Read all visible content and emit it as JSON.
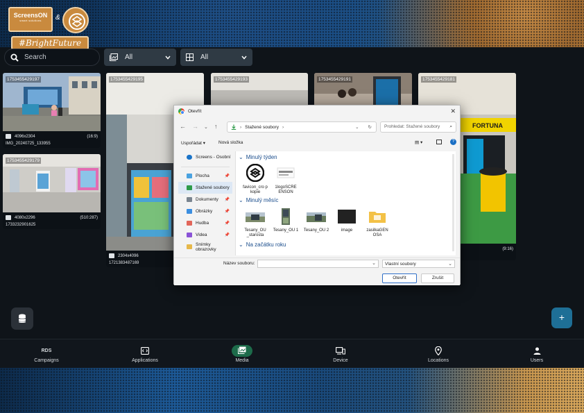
{
  "header": {
    "brand": "ScreensON",
    "brand_sub": "smart solutions",
    "amp": "&",
    "hashtag": "#BrightFuture",
    "search": {
      "placeholder": "Search"
    },
    "filter1": {
      "value": "All"
    },
    "filter2": {
      "value": "All"
    }
  },
  "tiles": [
    {
      "id": "1753455429197",
      "res": "4096x2304",
      "ratio": "(16:9)",
      "name": "IMG_20240725_133955"
    },
    {
      "id": "1753455429179",
      "res": "4080x2296",
      "ratio": "(510:287)",
      "name": "1733232901625"
    },
    {
      "id": "1753455429195",
      "res": "2304x4096",
      "ratio": "",
      "name": "1721383487169"
    },
    {
      "id": "1753455429193"
    },
    {
      "id": "1753455429191"
    },
    {
      "id": "1753455429181",
      "ratio": "(9:16)",
      "sign": "FORTUNA"
    }
  ],
  "dialog": {
    "title": "Otevřít",
    "path": "Stažené soubory",
    "search_placeholder": "Prohledat: Stažené soubory",
    "organize": "Uspořádat",
    "new_folder": "Nová složka",
    "nav": [
      {
        "label": "Screens - Osobní"
      },
      {
        "label": "Plocha"
      },
      {
        "label": "Stažené soubory"
      },
      {
        "label": "Dokumenty"
      },
      {
        "label": "Obrázky"
      },
      {
        "label": "Hudba"
      },
      {
        "label": "Videa"
      },
      {
        "label": "Snímky obrazovky"
      }
    ],
    "groups": [
      "Minulý týden",
      "Minulý měsíc",
      "Na začátku roku"
    ],
    "files_week": [
      "favicon_cro p kopie",
      "1logoSCRE ENSON"
    ],
    "files_month": [
      "Tesany_OU _starosta",
      "Tesany_OU 1",
      "Tesany_OU 2",
      "image",
      "zasilkaGEN OSA"
    ],
    "filename_label": "Název souboru:",
    "filetype": "Vlastní soubory",
    "open_btn": "Otevřít",
    "cancel_btn": "Zrušit"
  },
  "bottom_nav": [
    {
      "label": "Campaigns",
      "icon_text": "RDS"
    },
    {
      "label": "Applications"
    },
    {
      "label": "Media"
    },
    {
      "label": "Device"
    },
    {
      "label": "Locations"
    },
    {
      "label": "Users"
    }
  ],
  "fab_add": "+"
}
